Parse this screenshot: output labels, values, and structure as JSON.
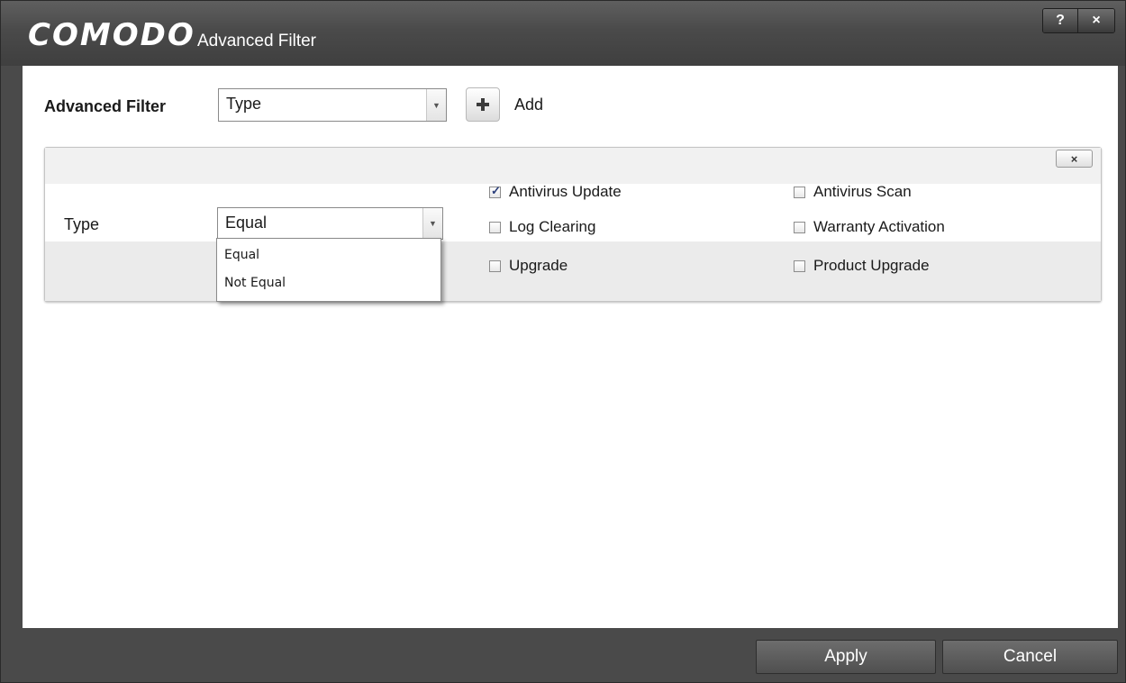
{
  "window": {
    "brand": "COMODO",
    "title": "Advanced Filter",
    "help_label": "?",
    "close_label": "×"
  },
  "filter_bar": {
    "label": "Advanced Filter",
    "selected": "Type",
    "add_label": "Add"
  },
  "panel": {
    "close_label": "×",
    "field_label": "Type",
    "operator_selected": "Equal",
    "operator_options": [
      "Equal",
      "Not Equal"
    ],
    "checkboxes": [
      {
        "label": "Antivirus Update",
        "checked": true
      },
      {
        "label": "Antivirus Scan",
        "checked": false
      },
      {
        "label": "Log Clearing",
        "checked": false
      },
      {
        "label": "Warranty Activation",
        "checked": false
      },
      {
        "label": "Upgrade",
        "checked": false
      },
      {
        "label": "Product Upgrade",
        "checked": false
      }
    ]
  },
  "footer": {
    "apply_label": "Apply",
    "cancel_label": "Cancel"
  }
}
